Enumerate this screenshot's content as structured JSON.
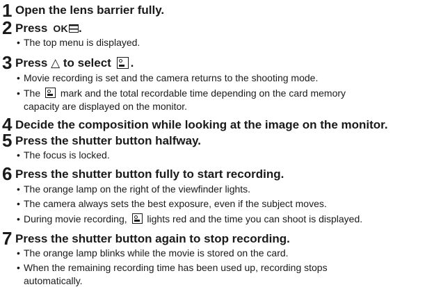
{
  "steps": [
    {
      "num": "1",
      "title": "Open the lens barrier fully."
    },
    {
      "num": "2",
      "title_prefix": "Press",
      "ok_label": "OK",
      "title_suffix": ".",
      "bullets": [
        "The top menu is displayed."
      ]
    },
    {
      "num": "3",
      "title_prefix": "Press",
      "arrow": "△",
      "title_mid": "to select",
      "title_suffix": ".",
      "bullets": [
        "Movie recording is set and the camera returns to the shooting mode.",
        {
          "pre": "The",
          "post": "mark and the total recordable time depending on the card memory"
        },
        "capacity are displayed on the monitor."
      ]
    },
    {
      "num": "4",
      "title": "Decide the composition while looking at the image on the monitor."
    },
    {
      "num": "5",
      "title": "Press the shutter button halfway.",
      "bullets": [
        "The focus is locked."
      ]
    },
    {
      "num": "6",
      "title": "Press the shutter button fully to start recording.",
      "bullets": [
        "The orange lamp on the right of the viewfinder lights.",
        "The camera always sets the best exposure, even if the subject moves.",
        {
          "pre": "During movie recording,",
          "post": "lights red and the time you can shoot is displayed."
        }
      ]
    },
    {
      "num": "7",
      "title": "Press the shutter button again to stop recording.",
      "bullets": [
        "The orange lamp blinks while the movie is stored on the card.",
        "When the remaining recording time has been used up, recording stops",
        "automatically."
      ]
    }
  ],
  "icons": {
    "movie": "movie-mode-icon",
    "menu": "menu-icon",
    "arrow_up": "up-arrow-icon"
  }
}
